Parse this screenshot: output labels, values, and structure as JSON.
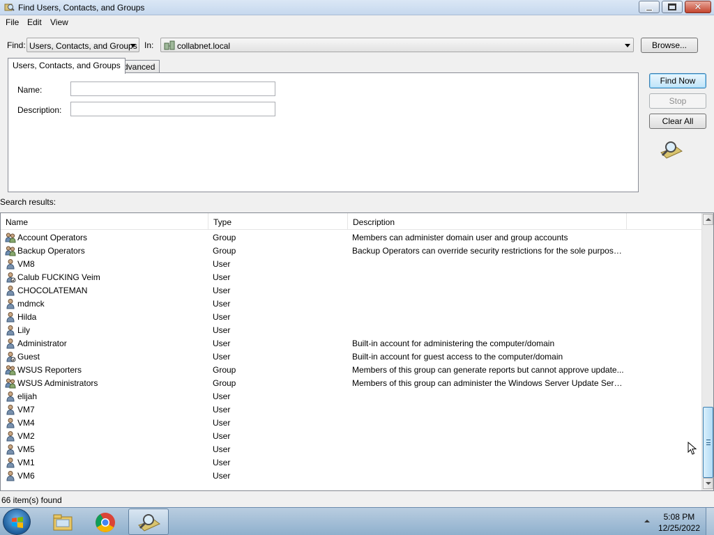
{
  "window": {
    "title": "Find Users, Contacts, and Groups"
  },
  "menu": [
    "File",
    "Edit",
    "View"
  ],
  "find": {
    "label": "Find:",
    "value": "Users, Contacts, and Groups",
    "in_label": "In:",
    "in_value": "collabnet.local",
    "browse_label": "Browse..."
  },
  "tabs": [
    "Users, Contacts, and Groups",
    "Advanced"
  ],
  "form": {
    "name_label": "Name:",
    "name_value": "",
    "description_label": "Description:",
    "description_value": ""
  },
  "actions": {
    "find_now": "Find Now",
    "stop": "Stop",
    "clear_all": "Clear All"
  },
  "results": {
    "label": "Search results:",
    "columns": [
      "Name",
      "Type",
      "Description"
    ],
    "rows": [
      {
        "name": "Account Operators",
        "type": "Group",
        "description": "Members can administer domain user and group accounts",
        "icon": "group-icon"
      },
      {
        "name": "Backup Operators",
        "type": "Group",
        "description": "Backup Operators can override security restrictions for the sole purpose ...",
        "icon": "group-icon"
      },
      {
        "name": "VM8",
        "type": "User",
        "description": "",
        "icon": "user-icon"
      },
      {
        "name": "Calub FUCKING Veim",
        "type": "User",
        "description": "",
        "icon": "user-disabled-icon"
      },
      {
        "name": "CHOCOLATEMAN",
        "type": "User",
        "description": "",
        "icon": "user-icon"
      },
      {
        "name": "mdmck",
        "type": "User",
        "description": "",
        "icon": "user-icon"
      },
      {
        "name": "Hilda",
        "type": "User",
        "description": "",
        "icon": "user-icon"
      },
      {
        "name": "Lily",
        "type": "User",
        "description": "",
        "icon": "user-icon"
      },
      {
        "name": "Administrator",
        "type": "User",
        "description": "Built-in account for administering the computer/domain",
        "icon": "user-icon"
      },
      {
        "name": "Guest",
        "type": "User",
        "description": "Built-in account for guest access to the computer/domain",
        "icon": "user-disabled-icon"
      },
      {
        "name": "WSUS Reporters",
        "type": "Group",
        "description": "Members of this group can generate reports but cannot approve update...",
        "icon": "group-icon"
      },
      {
        "name": "WSUS Administrators",
        "type": "Group",
        "description": "Members of this group can administer the Windows Server Update Servi...",
        "icon": "group-icon"
      },
      {
        "name": "elijah",
        "type": "User",
        "description": "",
        "icon": "user-icon"
      },
      {
        "name": "VM7",
        "type": "User",
        "description": "",
        "icon": "user-icon"
      },
      {
        "name": "VM4",
        "type": "User",
        "description": "",
        "icon": "user-icon"
      },
      {
        "name": "VM2",
        "type": "User",
        "description": "",
        "icon": "user-icon"
      },
      {
        "name": "VM5",
        "type": "User",
        "description": "",
        "icon": "user-icon"
      },
      {
        "name": "VM1",
        "type": "User",
        "description": "",
        "icon": "user-icon"
      },
      {
        "name": "VM6",
        "type": "User",
        "description": "",
        "icon": "user-icon"
      }
    ]
  },
  "status": "66 item(s) found",
  "taskbar": {
    "apps": [
      "start-orb-icon",
      "explorer-icon",
      "chrome-icon",
      "find-users-icon"
    ],
    "time": "5:08 PM",
    "date": "12/25/2022"
  },
  "colors": {
    "accent": "#3c7fb1",
    "title_bar": "#c6d8ee",
    "taskbar": "#8fb0cd"
  }
}
